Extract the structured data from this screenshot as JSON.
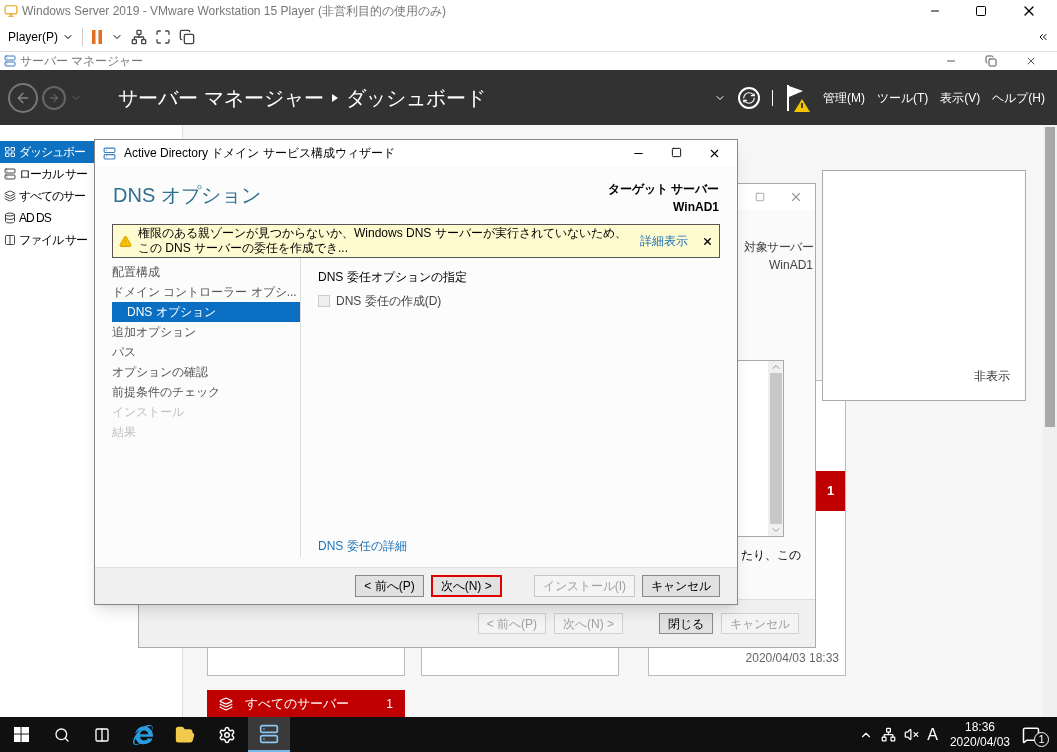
{
  "vm_window": {
    "title": "Windows Server 2019 - VMware Workstation 15 Player (非営利目的の使用のみ)"
  },
  "vm_toolbar": {
    "player_menu": "Player(P)"
  },
  "server_manager": {
    "title": "サーバー マネージャー",
    "breadcrumb": [
      "サーバー マネージャー",
      "ダッシュボード"
    ],
    "menus": [
      "管理(M)",
      "ツール(T)",
      "表示(V)",
      "ヘルプ(H)"
    ],
    "sidebar": [
      {
        "label": "ダッシュボー",
        "selected": true
      },
      {
        "label": "ローカル サー",
        "selected": false
      },
      {
        "label": "すべてのサー",
        "selected": false
      },
      {
        "label": "AD DS",
        "selected": false
      },
      {
        "label": "ファイル サー",
        "selected": false
      }
    ]
  },
  "background": {
    "hide_label": "非表示",
    "target_label": "対象サーバー",
    "target_name": "WinAD1",
    "text_fragment": "たり、この",
    "buttons": [
      {
        "label": "< 前へ(P)",
        "disabled": true
      },
      {
        "label": "次へ(N) >",
        "disabled": true
      },
      {
        "label": "閉じる",
        "disabled": false
      },
      {
        "label": "キャンセル",
        "disabled": true
      }
    ],
    "tile_count": "1",
    "timestamp": "2020/04/03 18:33",
    "all_servers": {
      "label": "すべてのサーバー",
      "count": "1"
    }
  },
  "dialog": {
    "title": "Active Directory ドメイン サービス構成ウィザード",
    "heading": "DNS オプション",
    "target_label": "ターゲット サーバー",
    "target_name": "WinAD1",
    "warning": {
      "text": "権限のある親ゾーンが見つからないか、Windows DNS サーバーが実行されていないため、この DNS サーバーの委任を作成でき...",
      "link": "詳細表示"
    },
    "nav": [
      {
        "label": "配置構成",
        "selected": false,
        "disabled": false
      },
      {
        "label": "ドメイン コントローラー オプシ...",
        "selected": false,
        "disabled": false
      },
      {
        "label": "DNS オプション",
        "selected": true,
        "disabled": false
      },
      {
        "label": "追加オプション",
        "selected": false,
        "disabled": false
      },
      {
        "label": "パス",
        "selected": false,
        "disabled": false
      },
      {
        "label": "オプションの確認",
        "selected": false,
        "disabled": false
      },
      {
        "label": "前提条件のチェック",
        "selected": false,
        "disabled": false
      },
      {
        "label": "インストール",
        "selected": false,
        "disabled": true
      },
      {
        "label": "結果",
        "selected": false,
        "disabled": true
      }
    ],
    "section_title": "DNS 委任オプションの指定",
    "checkbox": {
      "label": "DNS 委任の作成(D)",
      "checked": false,
      "disabled": true
    },
    "help_link": "DNS 委任の詳細",
    "buttons": [
      {
        "label": "< 前へ(P)",
        "disabled": false,
        "highlighted": false
      },
      {
        "label": "次へ(N) >",
        "disabled": false,
        "highlighted": true
      },
      {
        "label": "インストール(I)",
        "disabled": true,
        "highlighted": false
      },
      {
        "label": "キャンセル",
        "disabled": false,
        "highlighted": false
      }
    ]
  },
  "taskbar": {
    "ime": "A",
    "time": "18:36",
    "date": "2020/04/03",
    "notifications": "1"
  }
}
